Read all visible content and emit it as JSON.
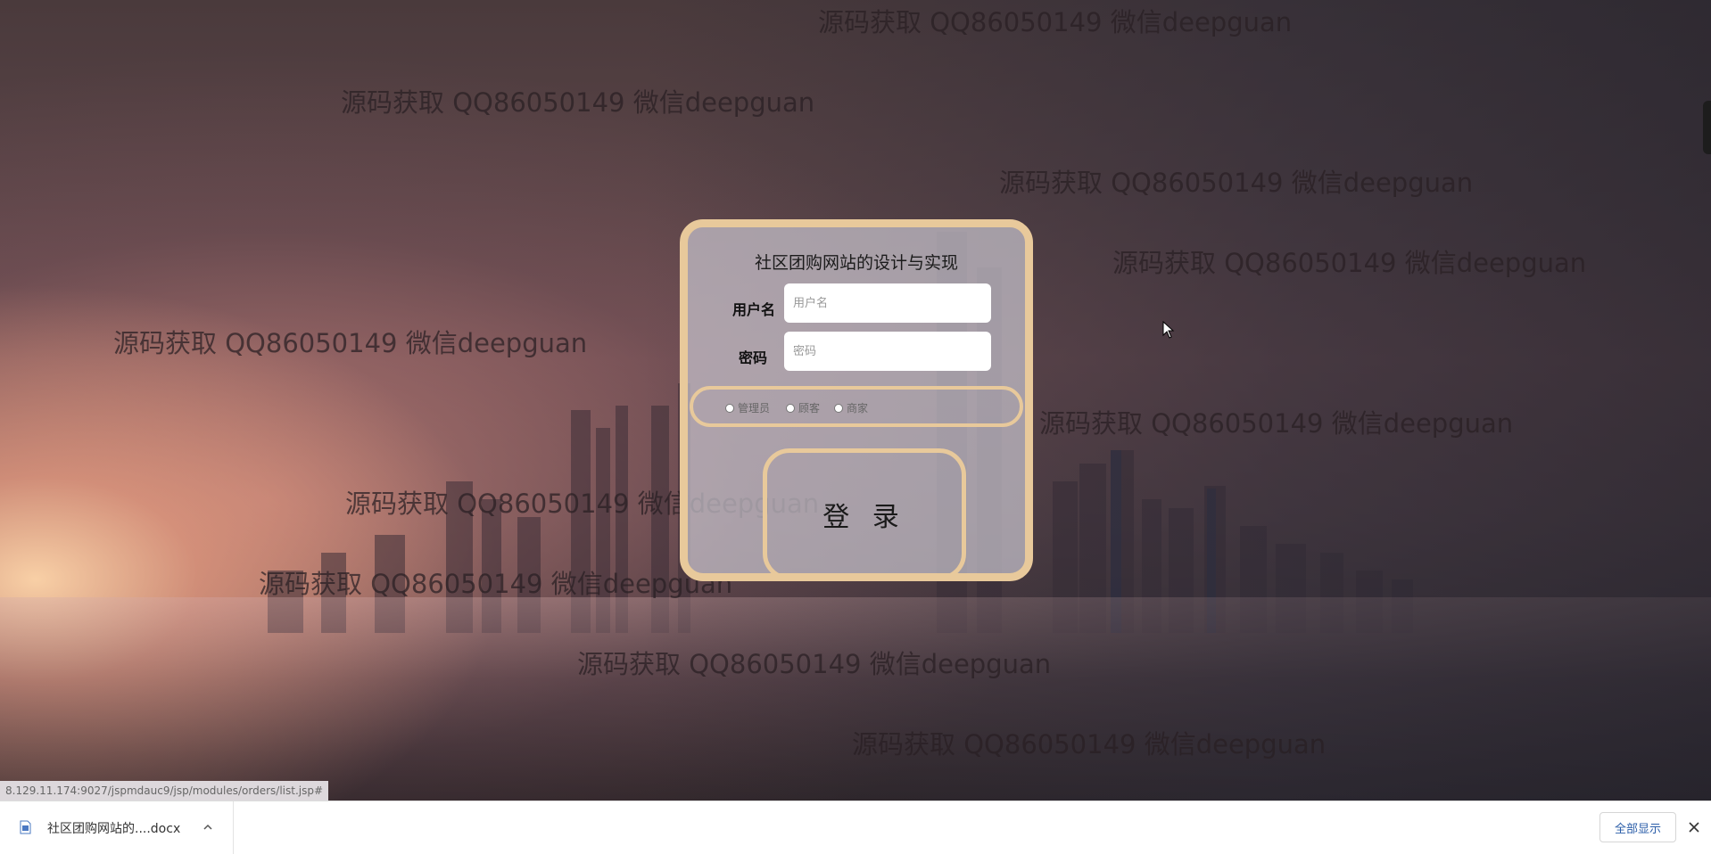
{
  "login": {
    "title": "社区团购网站的设计与实现",
    "username_label": "用户名",
    "username_placeholder": "用户名",
    "password_label": "密码",
    "password_placeholder": "密码",
    "roles": [
      "管理员",
      "顾客",
      "商家"
    ],
    "submit_label": "登 录"
  },
  "watermark_text": "源码获取 QQ86050149 微信deepguan",
  "status_url": "8.129.11.174:9027/jspmdauc9/jsp/modules/orders/list.jsp#",
  "download_bar": {
    "file_name": "社区团购网站的....docx",
    "file_icon": "word-document-icon",
    "expand_icon": "chevron-up-icon",
    "show_all_label": "全部显示",
    "close_icon": "close-icon"
  },
  "colors": {
    "card_border": "#e8c99b",
    "show_all_text": "#2a5da8"
  }
}
